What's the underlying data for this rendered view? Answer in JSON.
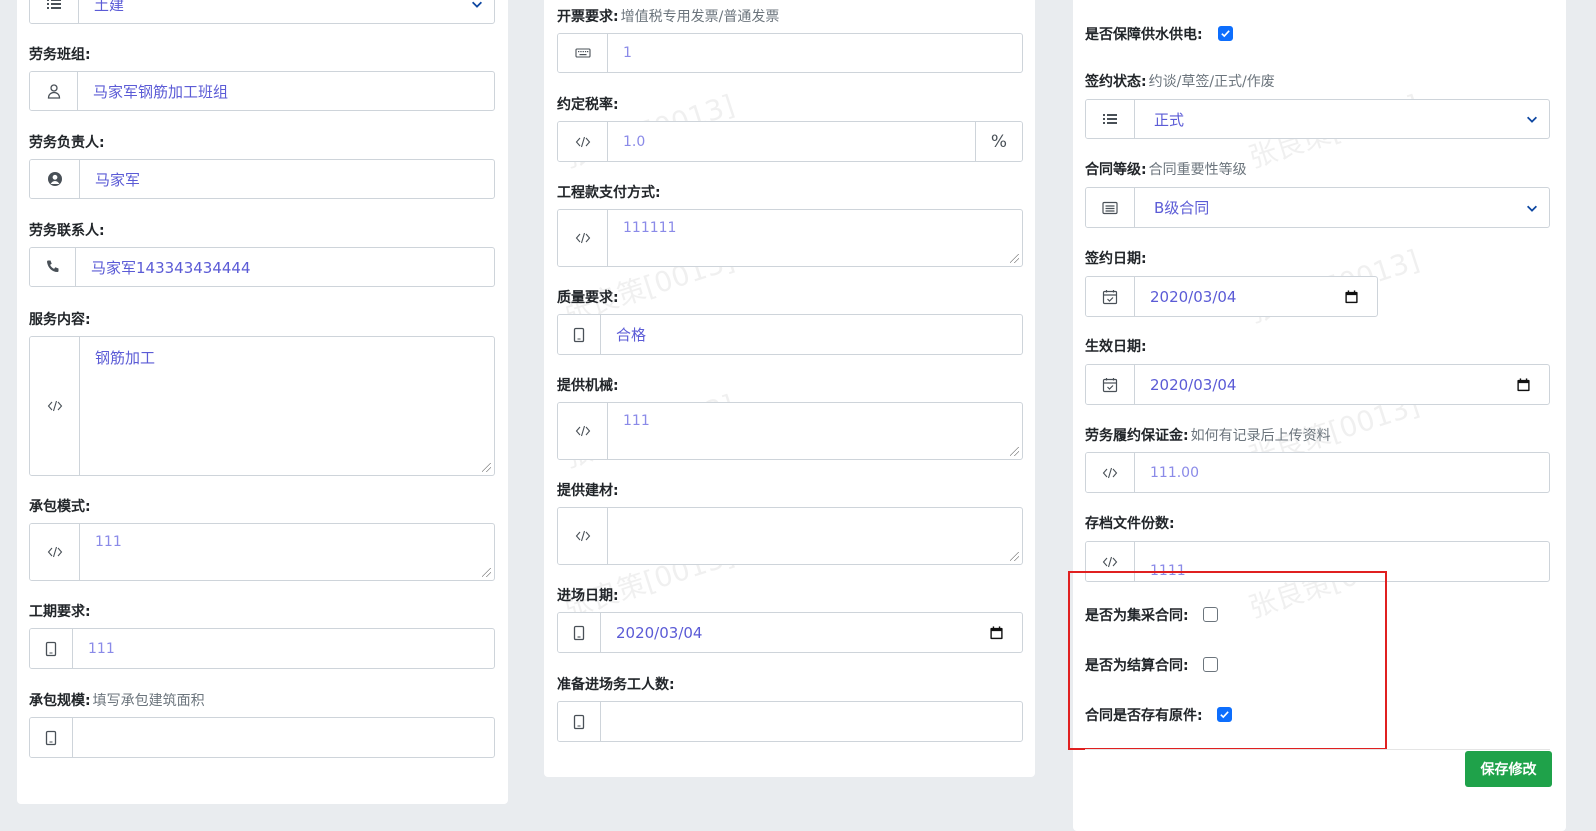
{
  "form": {
    "col1": {
      "type_select": {
        "value": "土建"
      },
      "team": {
        "label": "劳务班组:",
        "value": "马家军钢筋加工班组"
      },
      "leader": {
        "label": "劳务负责人:",
        "value": "马家军"
      },
      "contact": {
        "label": "劳务联系人:",
        "value": "马家军143343434444"
      },
      "service": {
        "label": "服务内容:",
        "value": "钢筋加工"
      },
      "mode": {
        "label": "承包模式:",
        "value": "111"
      },
      "period": {
        "label": "工期要求:",
        "value": "111"
      },
      "scale": {
        "label": "承包规模:",
        "hint": "填写承包建筑面积",
        "value": ""
      }
    },
    "col2": {
      "invoice": {
        "label": "开票要求:",
        "hint": "增值税专用发票/普通发票",
        "value": "1"
      },
      "tax": {
        "label": "约定税率:",
        "value": "1.0",
        "suffix": "%"
      },
      "payment": {
        "label": "工程款支付方式:",
        "value": "111111"
      },
      "quality": {
        "label": "质量要求:",
        "value": "合格"
      },
      "machinery": {
        "label": "提供机械:",
        "value": "111"
      },
      "materials": {
        "label": "提供建材:",
        "value": ""
      },
      "entry_date": {
        "label": "进场日期:",
        "value": "2020/03/04"
      },
      "workers": {
        "label": "准备进场务工人数:",
        "value": ""
      }
    },
    "col3": {
      "power": {
        "label": "是否保障供水供电:",
        "checked": true
      },
      "status": {
        "label": "签约状态:",
        "hint": "约谈/草签/正式/作废",
        "value": "正式"
      },
      "grade": {
        "label": "合同等级:",
        "hint": "合同重要性等级",
        "value": "B级合同"
      },
      "sign_date": {
        "label": "签约日期:",
        "value": "2020/03/04"
      },
      "effective_date": {
        "label": "生效日期:",
        "value": "2020/03/04"
      },
      "deposit": {
        "label": "劳务履约保证金:",
        "hint": "如何有记录后上传资料",
        "value": "111.00"
      },
      "archive": {
        "label": "存档文件份数:",
        "value": "1111"
      },
      "collective": {
        "label": "是否为集采合同:",
        "checked": false
      },
      "settlement": {
        "label": "是否为结算合同:",
        "checked": false
      },
      "original": {
        "label": "合同是否存有原件:",
        "checked": true
      }
    },
    "save_label": "保存修改"
  },
  "watermark": "张良策[0013]",
  "colors": {
    "accent": "#0d6efd",
    "value_text": "#5b5bd6",
    "save": "#1fa24a",
    "highlight": "#e02020"
  }
}
